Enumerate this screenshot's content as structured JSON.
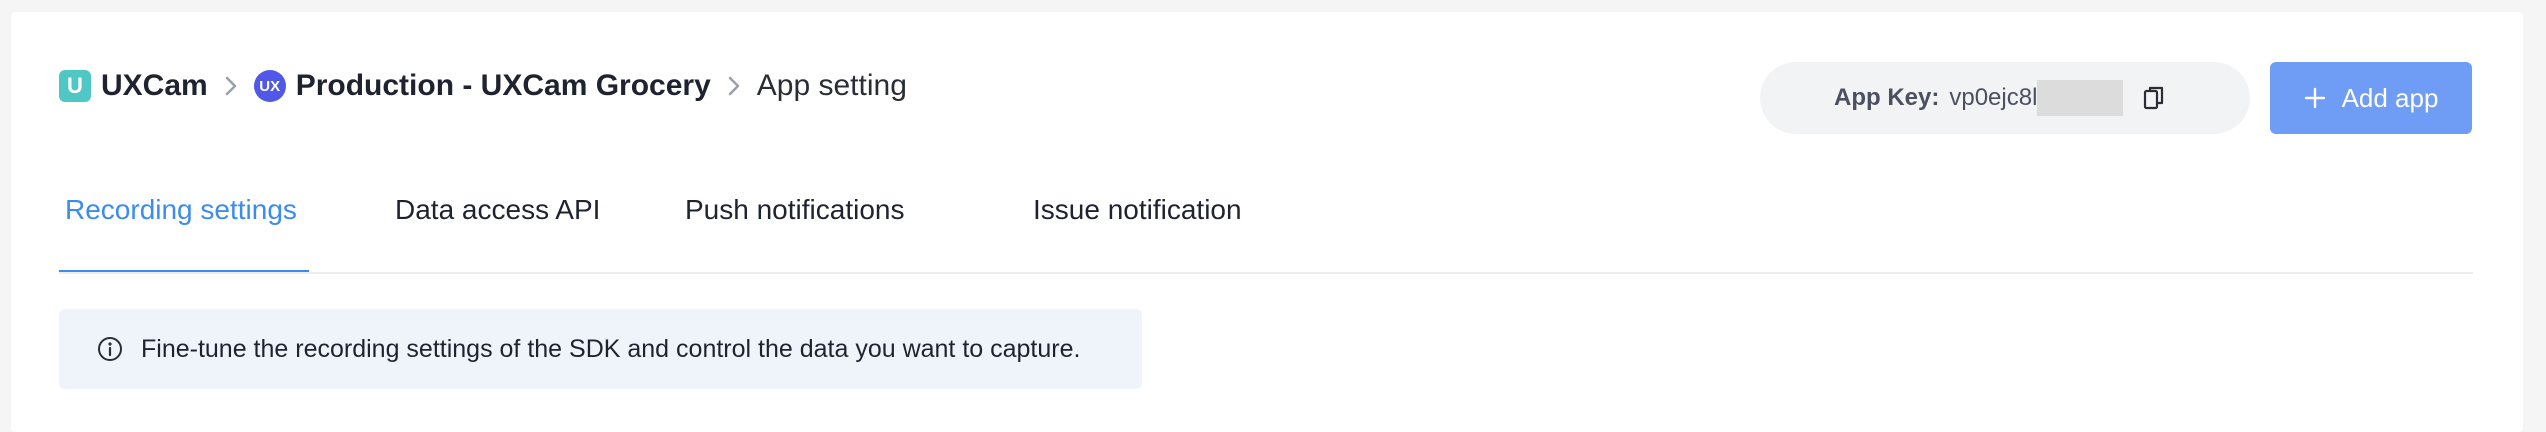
{
  "breadcrumb": {
    "org_badge": "U",
    "org": "UXCam",
    "app_badge": "UX",
    "app": "Production - UXCam Grocery",
    "current": "App setting"
  },
  "app_key": {
    "label": "App Key:",
    "value": "vp0ejc8l"
  },
  "add_app_label": "Add app",
  "tabs": [
    {
      "label": "Recording settings",
      "active": true
    },
    {
      "label": "Data access API",
      "active": false
    },
    {
      "label": "Push notifications",
      "active": false
    },
    {
      "label": "Issue notification",
      "active": false
    }
  ],
  "info": {
    "text": "Fine-tune the recording settings of the SDK and control the data you want to capture."
  },
  "colors": {
    "accent": "#3b8cf0",
    "button": "#6f9cf5",
    "org_logo": "#4fc7c4",
    "app_logo": "#5058e8",
    "info_bg": "#eff4fb"
  },
  "icons": {
    "chevron": "chevron-right-icon",
    "copy": "copy-icon",
    "plus": "plus-icon",
    "info": "info-icon"
  }
}
